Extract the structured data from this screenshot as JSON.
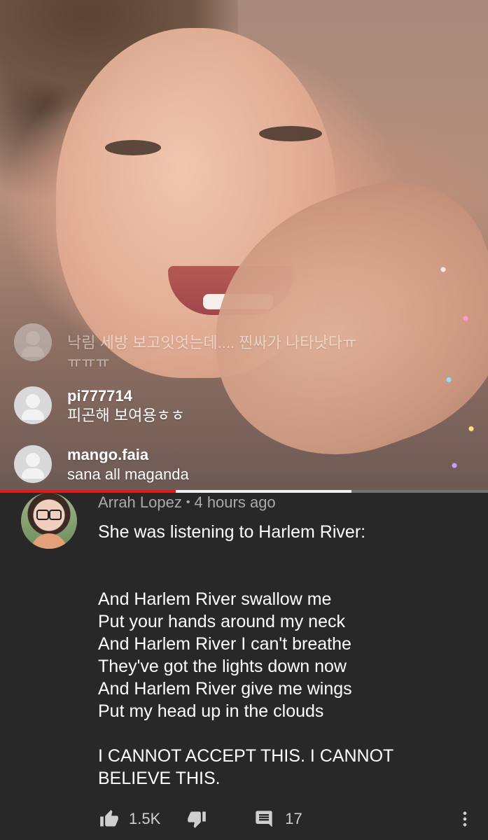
{
  "video": {
    "live_comments": [
      {
        "user": "",
        "message": "낙림 세방 보고잇엇는데.... 찐싸가 나타낫다ㅠ",
        "message2": "ㅠㅠㅠ"
      },
      {
        "user": "pi777714",
        "message": "피곤해 보여용ㅎㅎ"
      },
      {
        "user": "mango.faia",
        "message": "sana all maganda"
      }
    ],
    "progress": {
      "played": 0.36,
      "buffered": 0.72
    }
  },
  "comment": {
    "author": "Arrah Lopez",
    "separator": "•",
    "time": "4 hours ago",
    "text": "She was listening to Harlem River:\n\n\nAnd Harlem River swallow me\nPut your hands around my neck\nAnd Harlem River I can't breathe\nThey've got the lights down now\nAnd Harlem River give me wings\nPut my head up in the clouds\n\nI CANNOT ACCEPT THIS. I CANNOT\nBELIEVE THIS.",
    "likes": "1.5K",
    "replies": "17"
  },
  "colors": {
    "background": "#282828",
    "progress_played": "#e31b1b",
    "meta_text": "#aaaaaa"
  },
  "icons": [
    "thumbs-up-icon",
    "thumbs-down-icon",
    "reply-icon",
    "more-vert-icon"
  ]
}
